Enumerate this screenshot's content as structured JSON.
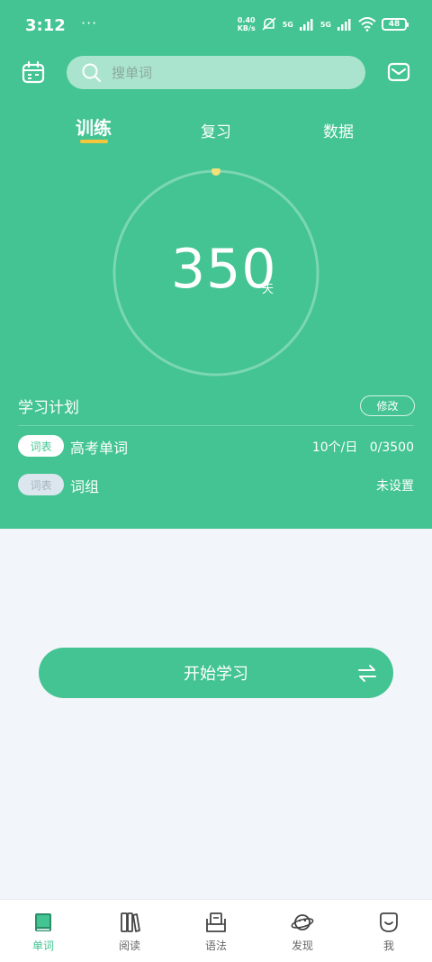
{
  "status_bar": {
    "time": "3:12",
    "dots": "···",
    "speed_top": "0.40",
    "speed_bottom": "KB/s",
    "net1": "5G",
    "net2": "5G",
    "battery": "48"
  },
  "header": {
    "search_placeholder": "搜单词"
  },
  "tabs": [
    "训练",
    "复习",
    "数据"
  ],
  "progress": {
    "days": "350",
    "unit": "天"
  },
  "plan": {
    "title": "学习计划",
    "edit_label": "修改",
    "rows": [
      {
        "tag": "词表",
        "name": "高考单词",
        "detail": "10个/日   0/3500"
      },
      {
        "tag": "词表",
        "name": "词组",
        "detail": "未设置"
      }
    ]
  },
  "start_button": {
    "label": "开始学习"
  },
  "bottom_nav": [
    "单词",
    "阅读",
    "语法",
    "发现",
    "我"
  ],
  "colors": {
    "brand": "#43c492",
    "accent": "#f5c63d",
    "background": "#f2f5f9"
  }
}
